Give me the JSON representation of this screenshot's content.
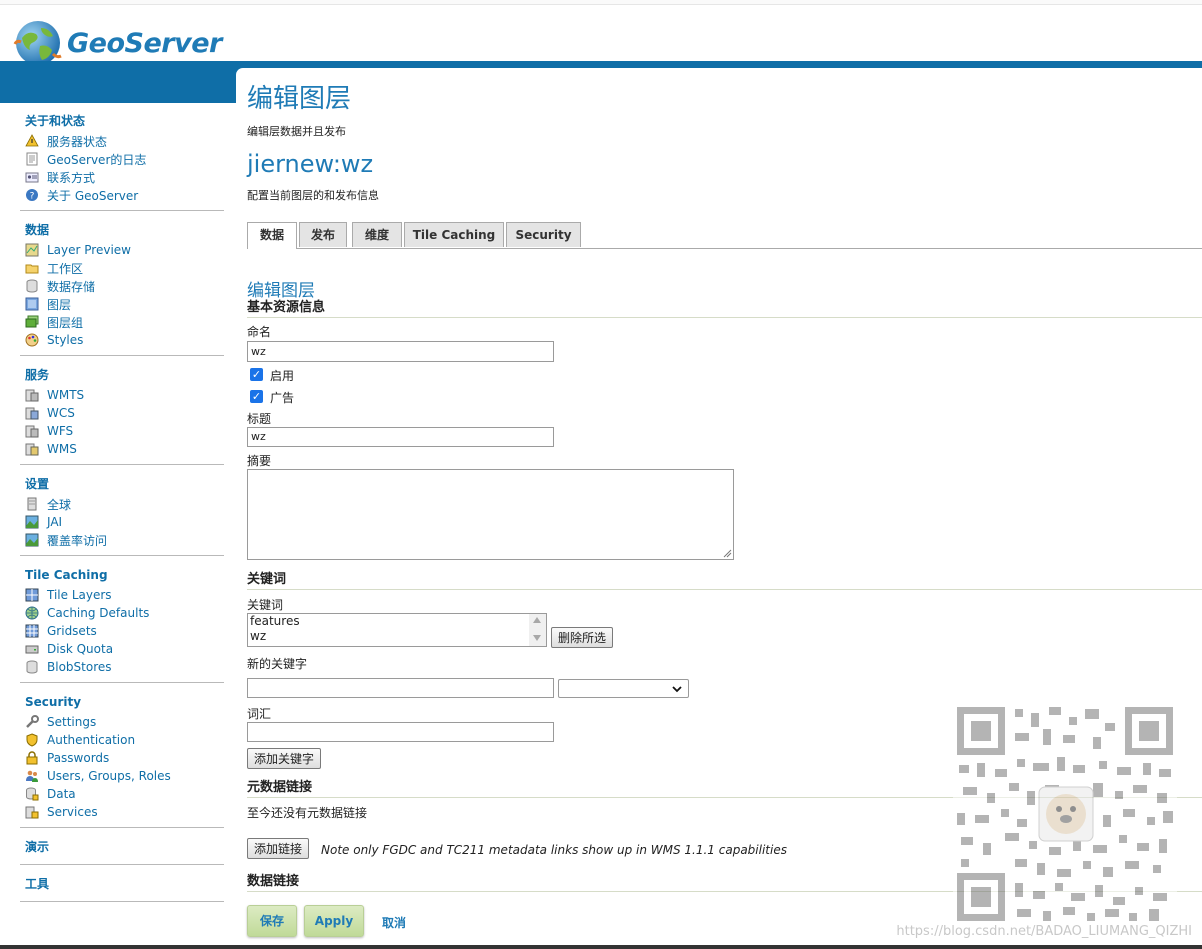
{
  "brand": {
    "name": "GeoServer"
  },
  "sidebar": {
    "sections": [
      {
        "title": "关于和状态",
        "items": [
          "服务器状态",
          "GeoServer的日志",
          "联系方式",
          "关于 GeoServer"
        ]
      },
      {
        "title": "数据",
        "items": [
          "Layer Preview",
          "工作区",
          "数据存储",
          "图层",
          "图层组",
          "Styles"
        ]
      },
      {
        "title": "服务",
        "items": [
          "WMTS",
          "WCS",
          "WFS",
          "WMS"
        ]
      },
      {
        "title": "设置",
        "items": [
          "全球",
          "JAI",
          "覆盖率访问"
        ]
      },
      {
        "title": "Tile Caching",
        "items": [
          "Tile Layers",
          "Caching Defaults",
          "Gridsets",
          "Disk Quota",
          "BlobStores"
        ]
      },
      {
        "title": "Security",
        "items": [
          "Settings",
          "Authentication",
          "Passwords",
          "Users, Groups, Roles",
          "Data",
          "Services"
        ]
      }
    ],
    "solo": [
      "演示",
      "工具"
    ]
  },
  "page": {
    "title": "编辑图层",
    "subtitle": "编辑层数据并且发布",
    "layer_name": "jiernew:wz",
    "layer_desc": "配置当前图层的和发布信息"
  },
  "tabs": [
    "数据",
    "发布",
    "维度",
    "Tile Caching",
    "Security"
  ],
  "form": {
    "heading": "编辑图层",
    "basic_section": "基本资源信息",
    "name_label": "命名",
    "name_value": "wz",
    "enabled_label": "启用",
    "advertised_label": "广告",
    "title_label": "标题",
    "title_value": "wz",
    "abstract_label": "摘要",
    "keywords_section": "关键词",
    "keywords_label": "关键词",
    "keywords": [
      "features",
      "wz"
    ],
    "remove_selected": "删除所选",
    "new_keyword_label": "新的关键字",
    "vocabulary_label": "词汇",
    "add_keyword": "添加关键字",
    "metadata_section": "元数据链接",
    "metadata_empty": "至今还没有元数据链接",
    "add_link": "添加链接",
    "metadata_note": "Note only FGDC and TC211 metadata links show up in WMS 1.1.1 capabilities",
    "datalinks_section": "数据链接"
  },
  "actions": {
    "save": "保存",
    "apply": "Apply",
    "cancel": "取消"
  },
  "watermark": "https://blog.csdn.net/BADAO_LIUMANG_QIZHI"
}
